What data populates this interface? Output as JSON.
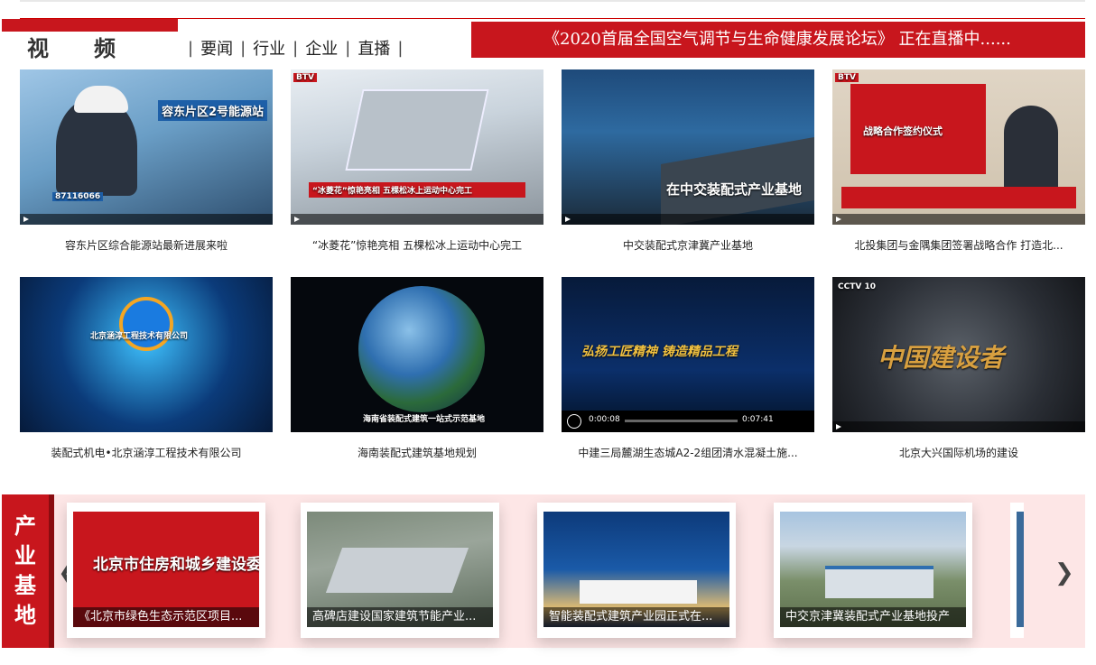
{
  "header": {
    "section_title": "视频",
    "tabs": [
      "要闻",
      "行业",
      "企业",
      "直播"
    ],
    "live_banner": "《2020首届全国空气调节与生命健康发展论坛》 正在直播中......"
  },
  "videos": [
    {
      "caption": "容东片区综合能源站最新进展来啦",
      "overlay": "容东片区2号能源站",
      "ticker": "87116066"
    },
    {
      "caption": "“冰菱花”惊艳亮相 五棵松冰上运动中心完工",
      "overlay": "“冰菱花”惊艳亮相 五棵松冰上运动中心完工",
      "badge": "BTV"
    },
    {
      "caption": "中交装配式京津冀产业基地",
      "overlay": "在中交装配式产业基地"
    },
    {
      "caption": "北投集团与金隅集团签署战略合作 打造北...",
      "overlay": "战略合作签约仪式",
      "badge": "BTV"
    },
    {
      "caption": "装配式机电•北京涵淳工程技术有限公司",
      "overlay": "北京涵淳工程技术有限公司"
    },
    {
      "caption": "海南装配式建筑基地规划",
      "overlay": "海南省装配式建筑一站式示范基地"
    },
    {
      "caption": "中建三局麓湖生态城A2-2组团清水混凝土施...",
      "overlay": "弘扬工匠精神 铸造精品工程",
      "time_start": "0:00:08",
      "time_end": "0:07:41"
    },
    {
      "caption": "北京大兴国际机场的建设",
      "overlay": "中国建设者",
      "badge": "CCTV 10"
    }
  ],
  "industry": {
    "tag": [
      "产",
      "业",
      "基",
      "地"
    ],
    "items": [
      {
        "label": "《北京市绿色生态示范区项目...",
        "overlay": "北京市住房和城乡建设委员会"
      },
      {
        "label": "高碑店建设国家建筑节能产业..."
      },
      {
        "label": "智能装配式建筑产业园正式在..."
      },
      {
        "label": "中交京津冀装配式产业基地投产"
      }
    ],
    "prev_icon": "chevron-left-icon",
    "next_icon": "chevron-right-icon"
  },
  "colors": {
    "accent": "#c8161d",
    "band": "#fde6e6"
  }
}
